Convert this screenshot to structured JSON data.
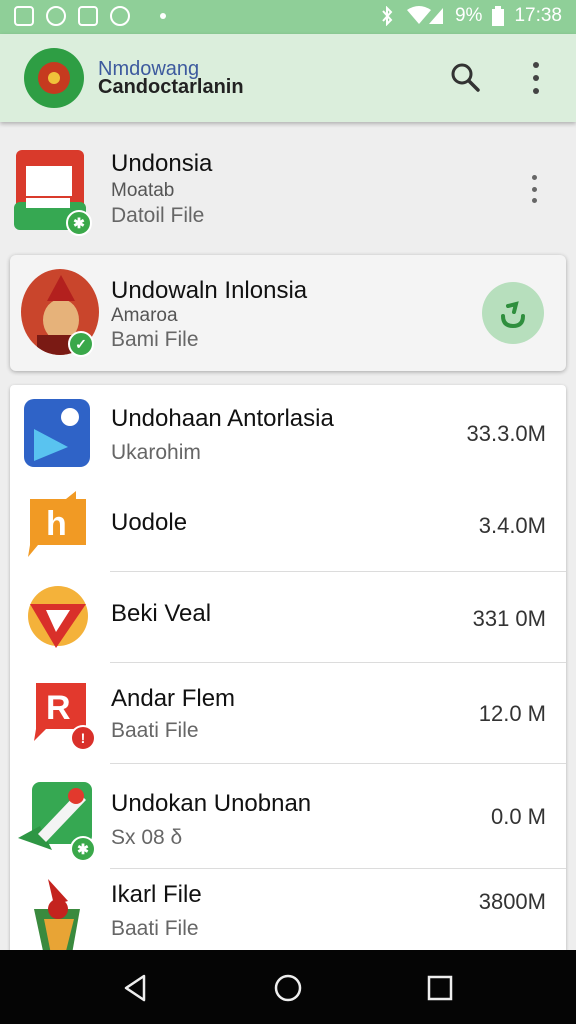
{
  "status_bar": {
    "battery": "9%",
    "time": "17:38"
  },
  "app_bar": {
    "title_top": "Nmdowang",
    "title": "Candoctarlanin"
  },
  "pinned": [
    {
      "title": "Undonsia",
      "line2": "Moatab",
      "line3": "Datoil File"
    },
    {
      "title": "Undowaln Inlonsia",
      "line2": "Amaroa",
      "line3": "Bami File"
    }
  ],
  "list": [
    {
      "title": "Undohaan Antorlasia",
      "subtitle": "Ukarohim",
      "size": "33.3.0M"
    },
    {
      "title": "Uodole",
      "subtitle": "",
      "size": "3.4.0M"
    },
    {
      "title": "Beki Veal",
      "subtitle": "",
      "size": "331 0M"
    },
    {
      "title": "Andar Flem",
      "subtitle": "Baati File",
      "size": "12.0 M"
    },
    {
      "title": "Undokan Unobnan",
      "subtitle": "Sx 08  δ",
      "size": "0.0 M"
    },
    {
      "title": "Ikarl File",
      "subtitle": "Baati File",
      "size": "3800M"
    }
  ]
}
